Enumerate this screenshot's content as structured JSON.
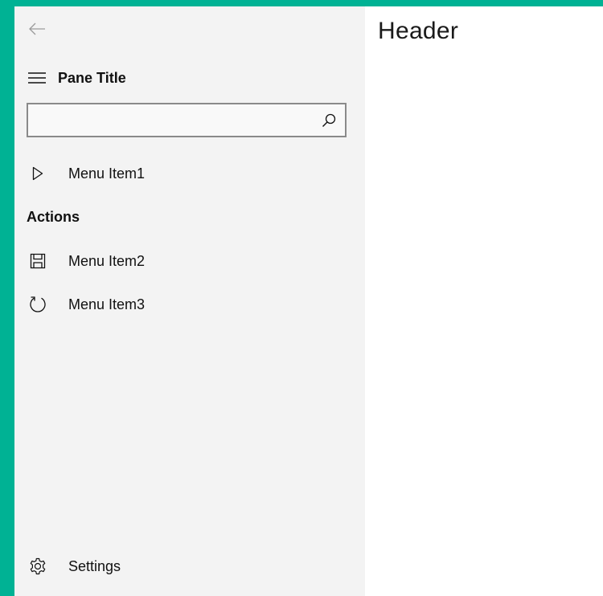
{
  "pane": {
    "title": "Pane Title",
    "search": {
      "value": "",
      "placeholder": ""
    },
    "menu_items": [
      {
        "label": "Menu Item1",
        "icon": "play-icon"
      }
    ],
    "section_header": "Actions",
    "action_items": [
      {
        "label": "Menu Item2",
        "icon": "save-icon"
      },
      {
        "label": "Menu Item3",
        "icon": "refresh-icon"
      }
    ],
    "settings_label": "Settings"
  },
  "content": {
    "header": "Header"
  },
  "colors": {
    "accent_background": "#00b294",
    "pane_background": "#f3f3f3",
    "content_background": "#ffffff"
  }
}
